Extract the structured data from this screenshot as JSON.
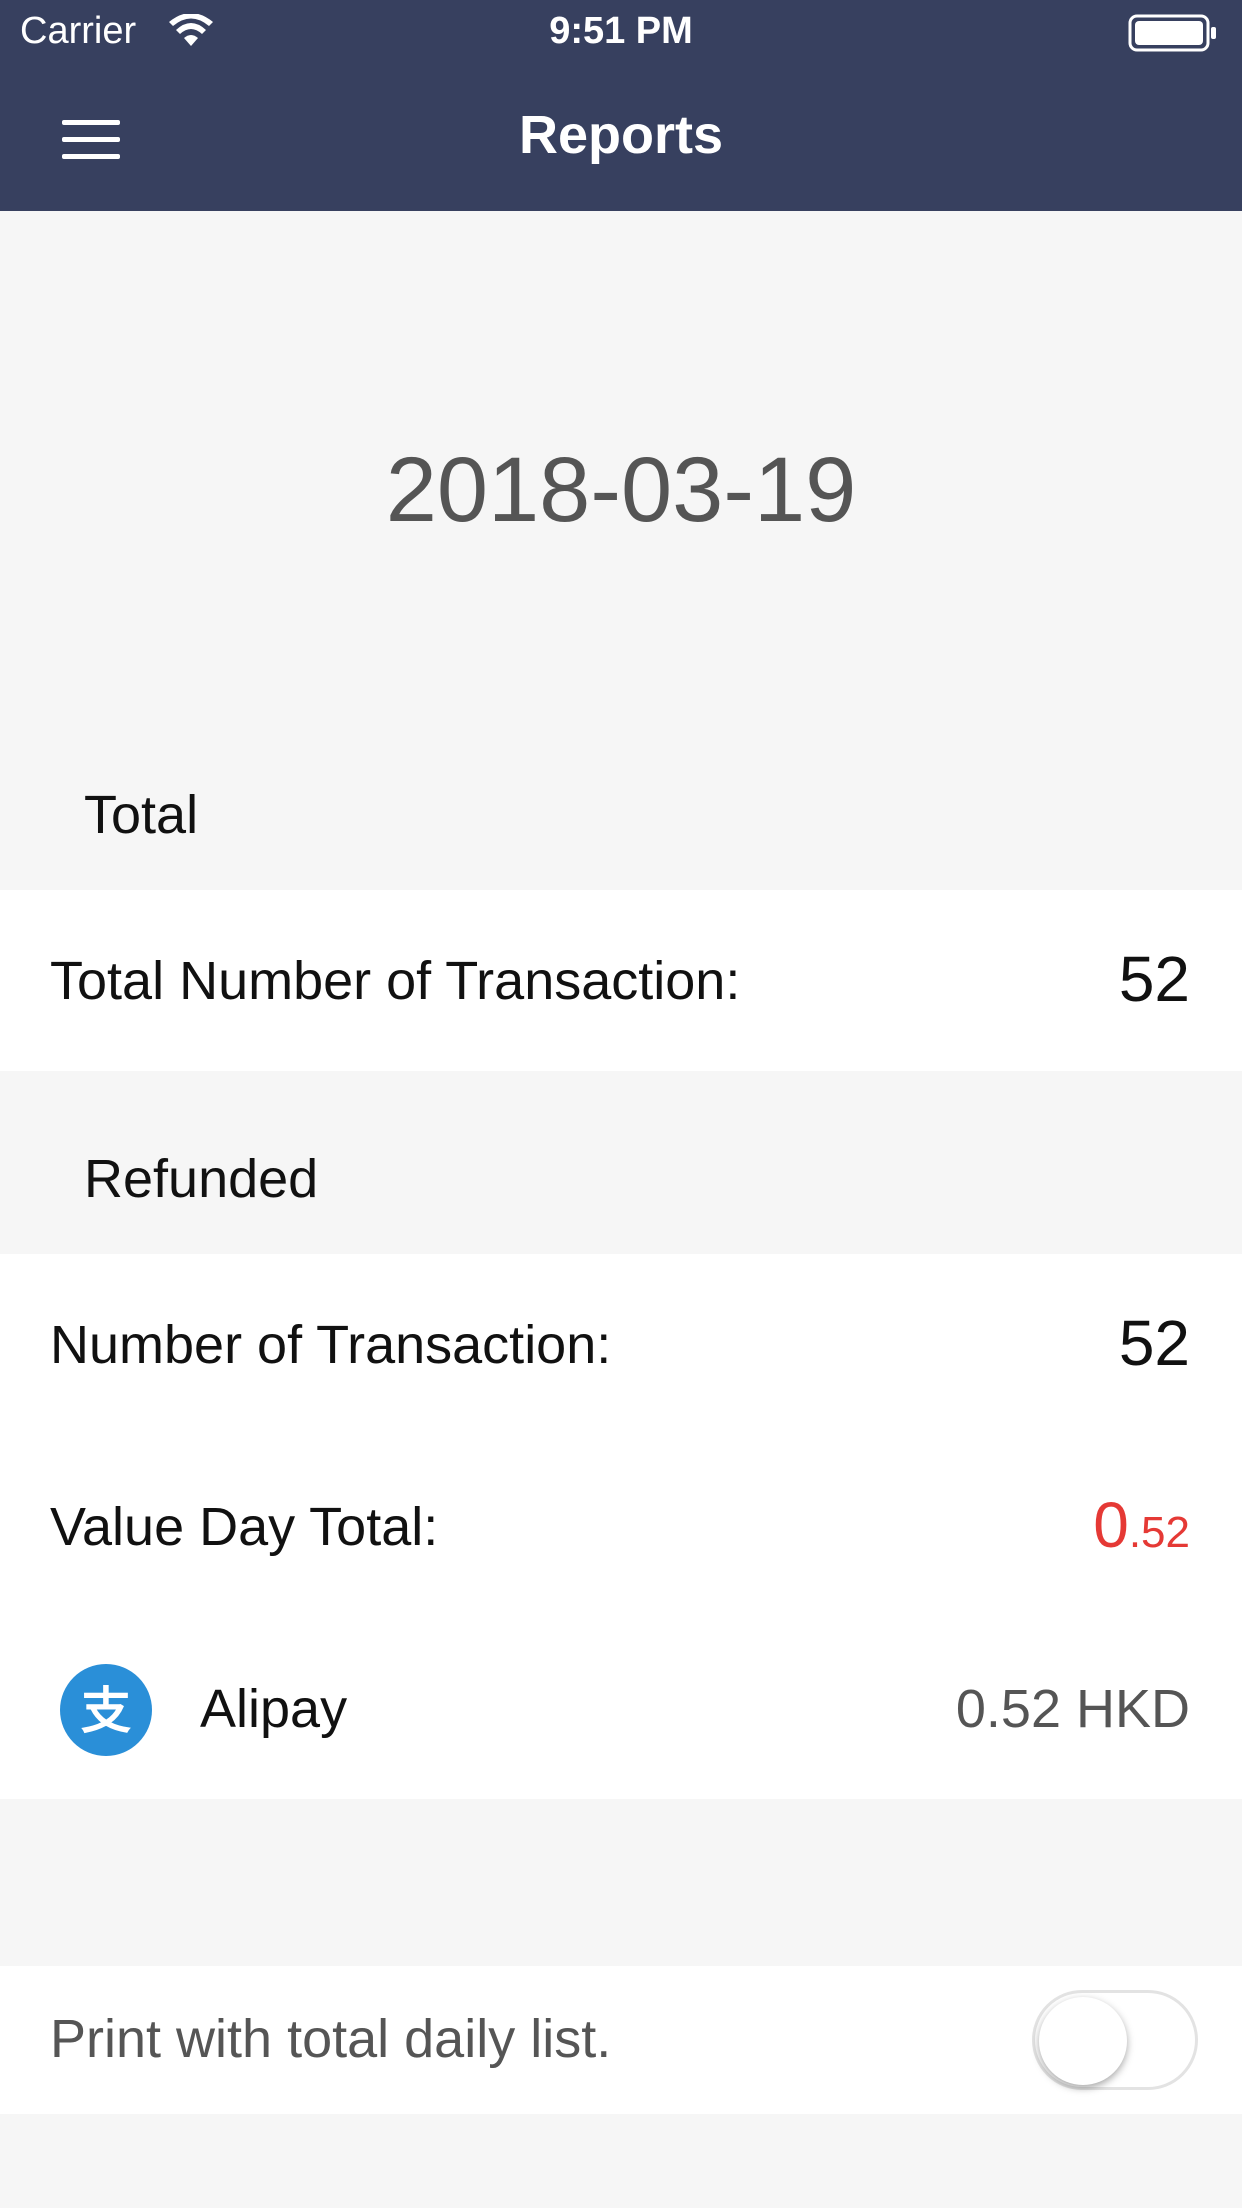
{
  "status_bar": {
    "carrier": "Carrier",
    "time": "9:51 PM"
  },
  "nav": {
    "title": "Reports",
    "menu_icon": "hamburger-menu-icon"
  },
  "report": {
    "date": "2018-03-19",
    "total_section": {
      "header": "Total",
      "transactions_label": "Total Number of Transaction:",
      "transactions_value": "52"
    },
    "refunded_section": {
      "header": "Refunded",
      "transactions_label": "Number of Transaction:",
      "transactions_value": "52",
      "value_day_label": "Value Day Total:",
      "value_day_int": "0",
      "value_day_dec": ".52",
      "value_color": "#e53935",
      "payment_method": {
        "icon": "alipay-icon",
        "name": "Alipay",
        "amount": "0.52 HKD"
      }
    }
  },
  "print_option": {
    "label": "Print with total daily list.",
    "enabled": false
  },
  "colors": {
    "header_bg": "#37405f",
    "page_bg": "#f6f6f6",
    "alipay_blue": "#2a8fd8"
  }
}
